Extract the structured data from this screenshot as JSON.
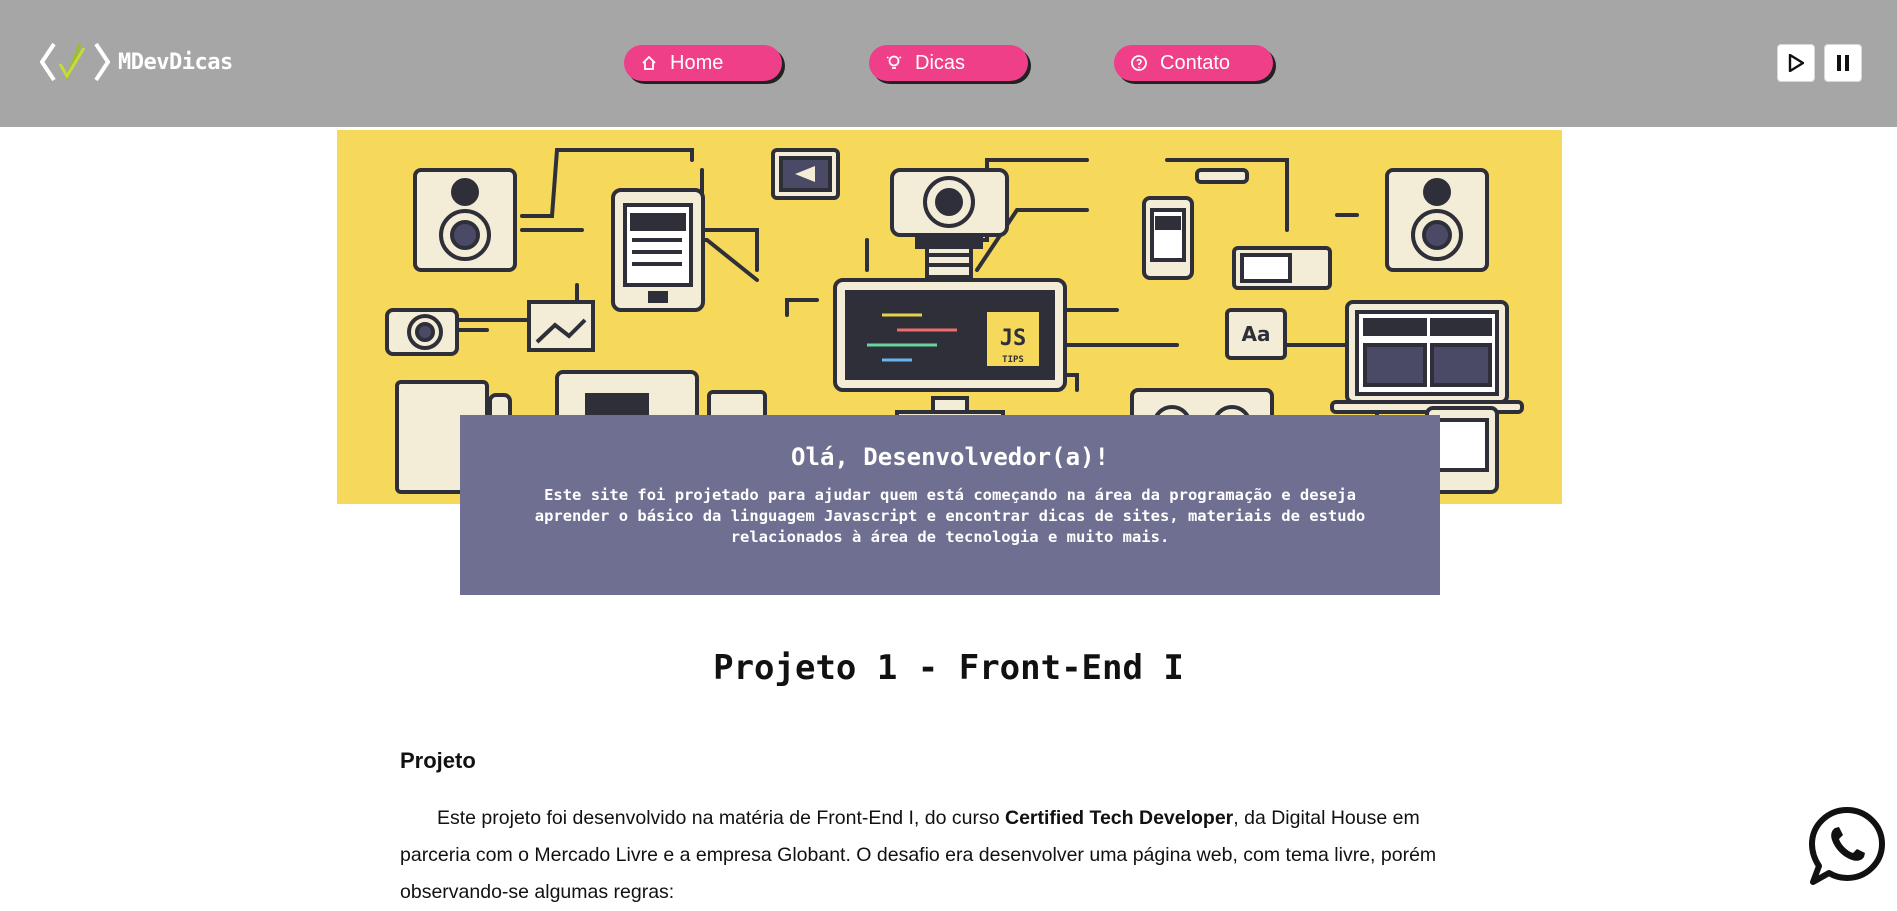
{
  "header": {
    "logo_text": "MDevDicas",
    "nav": [
      {
        "label": "Home",
        "icon": "home-icon"
      },
      {
        "label": "Dicas",
        "icon": "lightbulb-icon"
      },
      {
        "label": "Contato",
        "icon": "help-circle-icon"
      }
    ],
    "media": {
      "play_icon": "play-icon",
      "pause_icon": "pause-icon"
    }
  },
  "hero": {
    "badge_text": "JS",
    "badge_sub": "TIPS",
    "aa_text": "Aa"
  },
  "intro": {
    "title": "Olá, Desenvolvedor(a)!",
    "text": "Este site foi projetado para ajudar quem está começando na área da programação e deseja aprender o básico da linguagem Javascript e encontrar dicas de sites, materiais de estudo relacionados à área de tecnologia e muito mais."
  },
  "main": {
    "title": "Projeto 1 - Front-End I",
    "section_title": "Projeto",
    "para_before": "Este projeto foi desenvolvido na matéria de Front-End I, do curso ",
    "para_bold": "Certified Tech Developer",
    "para_after": ", da Digital House em parceria com o Mercado Livre e a empresa Globant. O desafio era desenvolver uma página web, com tema livre, porém observando-se algumas regras:"
  },
  "colors": {
    "header_bg": "#a6a6a6",
    "nav_button": "#ef3f88",
    "hero_bg": "#f6d95a",
    "intro_bg": "#6f6f91"
  },
  "floating": {
    "whatsapp_icon": "whatsapp-icon"
  }
}
